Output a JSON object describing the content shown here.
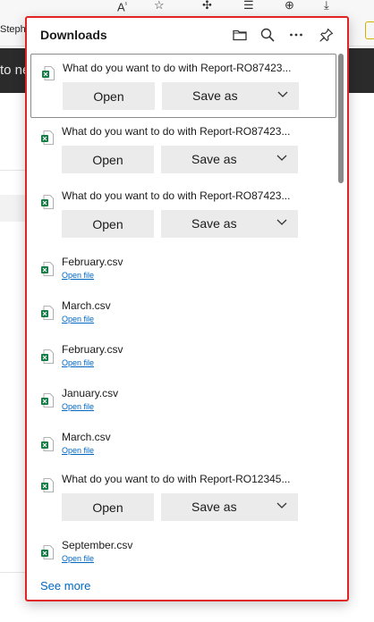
{
  "browser": {
    "bookmark_text": "Steph",
    "page_text": "to ne",
    "toolbar_icons": [
      "reader-mode-icon",
      "favorite-star-icon",
      "extensions-icon",
      "favorites-list-icon",
      "collections-icon",
      "downloads-icon"
    ]
  },
  "downloads": {
    "title": "Downloads",
    "header_buttons": [
      {
        "name": "open-folder-icon",
        "tooltip": "Open downloads folder"
      },
      {
        "name": "search-icon",
        "tooltip": "Search downloads"
      },
      {
        "name": "more-options-icon",
        "tooltip": "More options"
      },
      {
        "name": "pin-icon",
        "tooltip": "Pin downloads"
      }
    ],
    "items": [
      {
        "kind": "prompt",
        "text": "What do you want to do with Report-RO87423...",
        "open_label": "Open",
        "save_label": "Save as"
      },
      {
        "kind": "prompt",
        "text": "What do you want to do with Report-RO87423...",
        "open_label": "Open",
        "save_label": "Save as"
      },
      {
        "kind": "prompt",
        "text": "What do you want to do with Report-RO87423...",
        "open_label": "Open",
        "save_label": "Save as"
      },
      {
        "kind": "file",
        "filename": "February.csv",
        "link": "Open file"
      },
      {
        "kind": "file",
        "filename": "March.csv",
        "link": "Open file"
      },
      {
        "kind": "file",
        "filename": "February.csv",
        "link": "Open file"
      },
      {
        "kind": "file",
        "filename": "January.csv",
        "link": "Open file"
      },
      {
        "kind": "file",
        "filename": "March.csv",
        "link": "Open file"
      },
      {
        "kind": "prompt",
        "text": "What do you want to do with Report-RO12345...",
        "open_label": "Open",
        "save_label": "Save as"
      },
      {
        "kind": "file",
        "filename": "September.csv",
        "link": "Open file"
      }
    ],
    "see_more": "See more"
  },
  "colors": {
    "accent_link": "#0067c0",
    "excel_green": "#107c41",
    "highlight_border": "#e02424",
    "button_bg": "#ebebeb"
  }
}
